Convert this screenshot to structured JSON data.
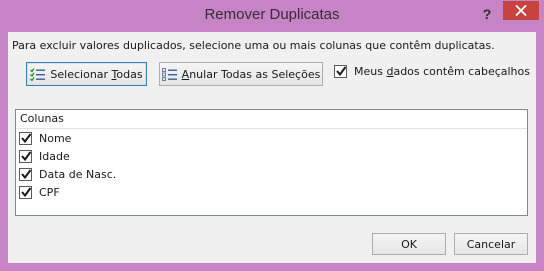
{
  "window": {
    "title": "Remover Duplicatas",
    "help_label": "?"
  },
  "dialog": {
    "instructions": "Para excluir valores duplicados, selecione uma ou mais colunas que contêm duplicatas.",
    "select_all": {
      "prefix": "Selecionar ",
      "mnemonic": "T",
      "suffix": "odas"
    },
    "unselect_all": {
      "prefix": "",
      "mnemonic": "A",
      "suffix": "nular Todas as Seleções"
    },
    "has_headers": {
      "prefix": "Meus ",
      "mnemonic": "d",
      "suffix": "ados contêm cabeçalhos",
      "checked": true
    },
    "list": {
      "header": "Colunas",
      "items": [
        {
          "label": "Nome",
          "checked": true
        },
        {
          "label": "Idade",
          "checked": true
        },
        {
          "label": "Data de Nasc.",
          "checked": true
        },
        {
          "label": "CPF",
          "checked": true
        }
      ]
    },
    "ok_label": "OK",
    "cancel_label": "Cancelar"
  },
  "colors": {
    "frame": "#c684c7",
    "close_button": "#c7433f",
    "client_bg": "#f0f0f0",
    "focus_border": "#3c7fb1"
  }
}
